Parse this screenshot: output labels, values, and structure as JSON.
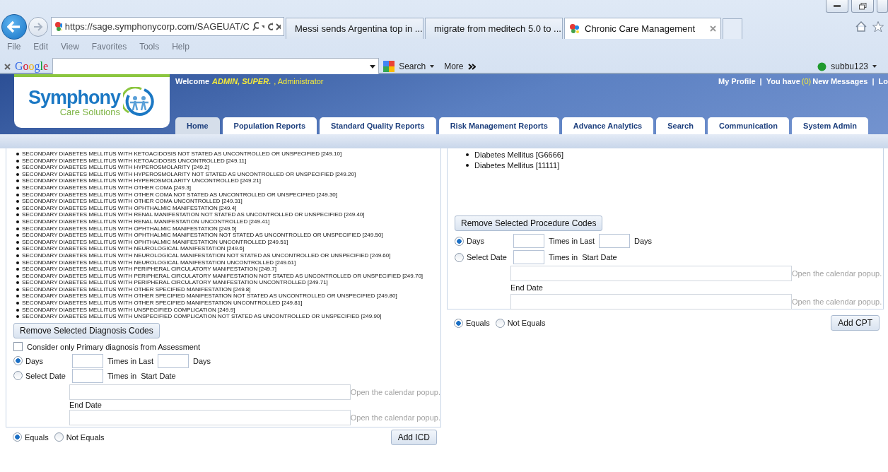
{
  "browser": {
    "address": "https://sage.symphonycorp.com/SAGEUAT/C",
    "tabs": [
      {
        "title": "Messi sends Argentina top in ...",
        "kind": "news",
        "selected": false
      },
      {
        "title": "migrate from meditech 5.0 to ...",
        "kind": "google",
        "selected": false
      },
      {
        "title": "Chronic Care Management",
        "kind": "app",
        "selected": true
      }
    ],
    "menu": [
      "File",
      "Edit",
      "View",
      "Favorites",
      "Tools",
      "Help"
    ],
    "toolbar": {
      "logo": "Google",
      "search": "Search",
      "more": "More",
      "user": "subbu123"
    }
  },
  "app": {
    "logo": {
      "name": "Symphony",
      "tagline": "Care Solutions"
    },
    "welcome": {
      "greeting": "Welcome",
      "name": "ADMIN, SUPER.",
      "role": ", Administrator"
    },
    "top_links": [
      {
        "kind": "link",
        "text": "My Profile"
      },
      {
        "kind": "sep",
        "text": "|"
      },
      {
        "kind": "text",
        "text": "You have"
      },
      {
        "kind": "count",
        "text": "(0)"
      },
      {
        "kind": "link",
        "text": "New Messages"
      },
      {
        "kind": "sep",
        "text": "|"
      },
      {
        "kind": "link",
        "text": "Lo"
      }
    ],
    "nav": [
      {
        "label": "Home",
        "selected": true
      },
      {
        "label": "Population Reports",
        "selected": false
      },
      {
        "label": "Standard Quality Reports",
        "selected": false
      },
      {
        "label": "Risk Management Reports",
        "selected": false
      },
      {
        "label": "Advance Analytics",
        "selected": false
      },
      {
        "label": "Search",
        "selected": false
      },
      {
        "label": "Communication",
        "selected": false
      },
      {
        "label": "System Admin",
        "selected": false
      }
    ]
  },
  "panels": [
    {
      "items": [
        "SECONDARY DIABETES MELLITUS WITH KETOACIDOSIS NOT STATED AS UNCONTROLLED OR UNSPECIFIED [249.10]",
        "SECONDARY DIABETES MELLITUS WITH KETOACIDOSIS UNCONTROLLED [249.11]",
        "SECONDARY DIABETES MELLITUS WITH HYPEROSMOLARITY [249.2]",
        "SECONDARY DIABETES MELLITUS WITH HYPEROSMOLARITY NOT STATED AS UNCONTROLLED OR UNSPECIFIED [249.20]",
        "SECONDARY DIABETES MELLITUS WITH HYPEROSMOLARITY UNCONTROLLED [249.21]",
        "SECONDARY DIABETES MELLITUS WITH OTHER COMA [249.3]",
        "SECONDARY DIABETES MELLITUS WITH OTHER COMA NOT STATED AS UNCONTROLLED OR UNSPECIFIED [249.30]",
        "SECONDARY DIABETES MELLITUS WITH OTHER COMA UNCONTROLLED [249.31]",
        "SECONDARY DIABETES MELLITUS WITH OPHTHALMIC MANIFESTATION [249.4]",
        "SECONDARY DIABETES MELLITUS WITH RENAL MANIFESTATION NOT STATED AS UNCONTROLLED OR UNSPECIFIED [249.40]",
        "SECONDARY DIABETES MELLITUS WITH RENAL MANIFESTATION UNCONTROLLED [249.41]",
        "SECONDARY DIABETES MELLITUS WITH OPHTHALMIC MANIFESTATION [249.5]",
        "SECONDARY DIABETES MELLITUS WITH OPHTHALMIC MANIFESTATION NOT STATED AS UNCONTROLLED OR UNSPECIFIED [249.50]",
        "SECONDARY DIABETES MELLITUS WITH OPHTHALMIC MANIFESTATION UNCONTROLLED [249.51]",
        "SECONDARY DIABETES MELLITUS WITH NEUROLOGICAL MANIFESTATION [249.6]",
        "SECONDARY DIABETES MELLITUS WITH NEUROLOGICAL MANIFESTATION NOT STATED AS UNCONTROLLED OR UNSPECIFIED [249.60]",
        "SECONDARY DIABETES MELLITUS WITH NEUROLOGICAL MANIFESTATION UNCONTROLLED [249.61]",
        "SECONDARY DIABETES MELLITUS WITH PERIPHERAL CIRCULATORY MANIFESTATION [249.7]",
        "SECONDARY DIABETES MELLITUS WITH PERIPHERAL CIRCULATORY MANIFESTATION NOT STATED AS UNCONTROLLED OR UNSPECIFIED [249.70]",
        "SECONDARY DIABETES MELLITUS WITH PERIPHERAL CIRCULATORY MANIFESTATION UNCONTROLLED [249.71]",
        "SECONDARY DIABETES MELLITUS WITH OTHER SPECIFIED MANIFESTATION [249.8]",
        "SECONDARY DIABETES MELLITUS WITH OTHER SPECIFIED MANIFESTATION NOT STATED AS UNCONTROLLED OR UNSPECIFIED [249.80]",
        "SECONDARY DIABETES MELLITUS WITH OTHER SPECIFIED MANIFESTATION UNCONTROLLED [249.81]",
        "SECONDARY DIABETES MELLITUS WITH UNSPECIFIED COMPLICATION [249.9]",
        "SECONDARY DIABETES MELLITUS WITH UNSPECIFIED COMPLICATION NOT STATED AS UNCONTROLLED OR UNSPECIFIED [249.90]"
      ],
      "remove_button": "Remove Selected Diagnosis Codes",
      "primary_only": {
        "label": "Consider only Primary diagnosis from Assessment",
        "checked": false
      },
      "modes": [
        {
          "label": "Days",
          "selected": true
        },
        {
          "label": "Select Date",
          "selected": false
        }
      ],
      "times_in_last": "Times in Last",
      "days": "Days",
      "times_in": "Times in",
      "start_date": "Start Date",
      "end_date": "End Date",
      "calendar_hints": [
        "Open the calendar popup.",
        "Open the calendar popup."
      ],
      "match": [
        {
          "label": "Equals",
          "selected": true
        },
        {
          "label": "Not Equals",
          "selected": false
        }
      ],
      "add_button": "Add ICD"
    },
    {
      "items": [
        "Diabetes Mellitus [G6666]",
        "Diabetes Mellitus [11111]"
      ],
      "remove_button": "Remove Selected Procedure Codes",
      "modes": [
        {
          "label": "Days",
          "selected": true
        },
        {
          "label": "Select Date",
          "selected": false
        }
      ],
      "times_in_last": "Times in Last",
      "days": "Days",
      "times_in": "Times in",
      "start_date": "Start Date",
      "end_date": "End Date",
      "calendar_hints": [
        "Open the calendar popup.",
        "Open the calendar popup."
      ],
      "match": [
        {
          "label": "Equals",
          "selected": true
        },
        {
          "label": "Not Equals",
          "selected": false
        }
      ],
      "add_button": "Add CPT"
    }
  ]
}
